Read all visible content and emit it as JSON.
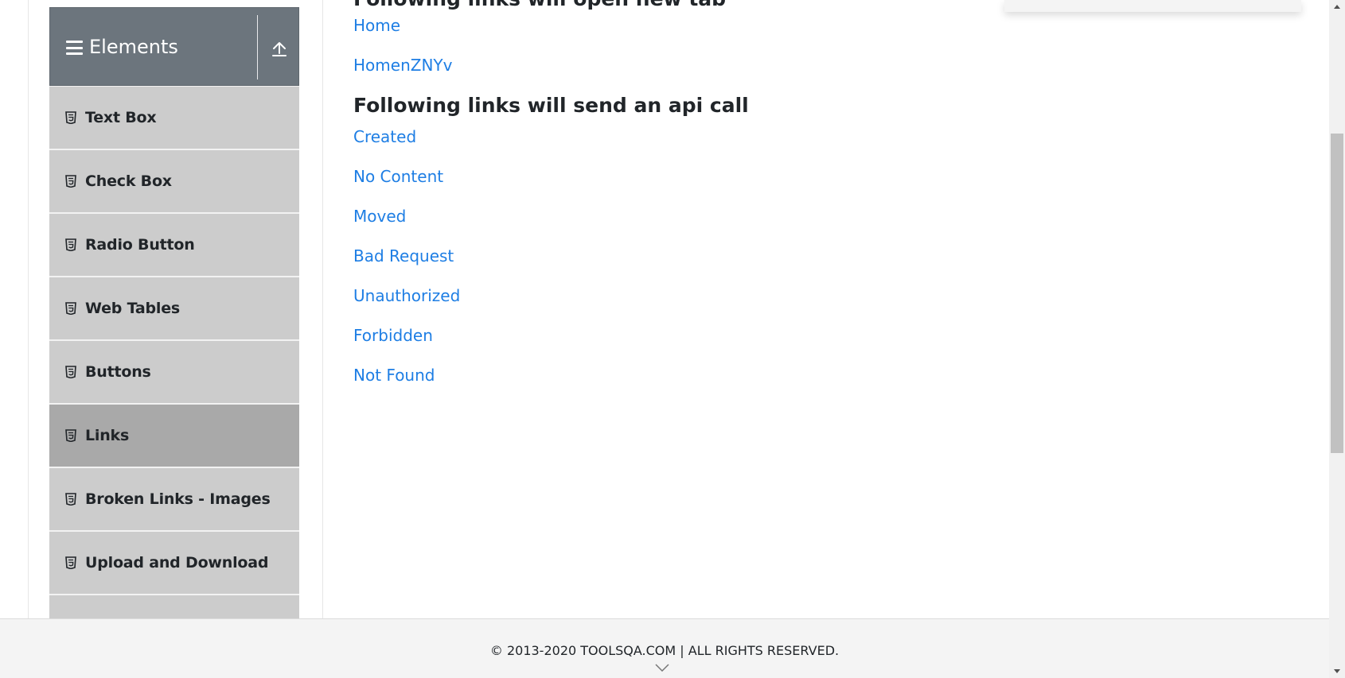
{
  "sidebar": {
    "group_title": "Elements",
    "items": [
      {
        "label": "Text Box"
      },
      {
        "label": "Check Box"
      },
      {
        "label": "Radio Button"
      },
      {
        "label": "Web Tables"
      },
      {
        "label": "Buttons"
      },
      {
        "label": "Links",
        "active": true
      },
      {
        "label": "Broken Links - Images"
      },
      {
        "label": "Upload and Download"
      },
      {
        "label": ""
      }
    ]
  },
  "main": {
    "heading_new_tab": "Following links will open new tab",
    "new_tab_links": [
      "Home",
      "HomenZNYv"
    ],
    "heading_api": "Following links will send an api call",
    "api_links": [
      "Created",
      "No Content",
      "Moved",
      "Bad Request",
      "Unauthorized",
      "Forbidden",
      "Not Found"
    ]
  },
  "footer": {
    "copyright": "© 2013-2020 TOOLSQA.COM | ALL RIGHTS RESERVED."
  },
  "colors": {
    "link": "#1e7ee4",
    "sidebar_header": "#6c757d",
    "menu_item": "#cccccc",
    "menu_item_active": "#a9a9a9"
  },
  "icons": {
    "menu": "hamburger-icon",
    "collapse": "arrow-up-icon",
    "item": "html5-icon",
    "footer": "chevron-down-icon"
  }
}
